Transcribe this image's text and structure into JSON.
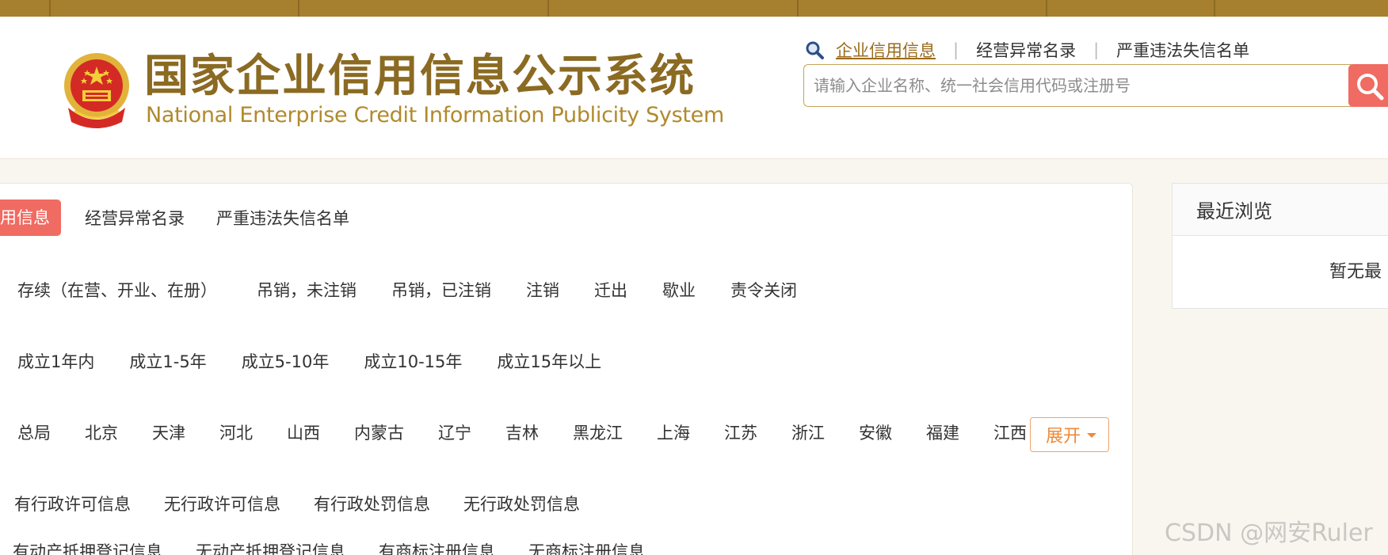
{
  "header": {
    "title_cn": "国家企业信用信息公示系统",
    "title_en": "National Enterprise Credit Information Publicity System",
    "search_tabs": [
      "企业信用信息",
      "经营异常名录",
      "严重违法失信名单"
    ],
    "search_placeholder": "请输入企业名称、统一社会信用代码或注册号"
  },
  "category_tabs": {
    "active": "用信息",
    "items": [
      "经营异常名录",
      "严重违法失信名单"
    ]
  },
  "filters": {
    "status": [
      "存续（在营、开业、在册）",
      "吊销，未注销",
      "吊销，已注销",
      "注销",
      "迁出",
      "歇业",
      "责令关闭"
    ],
    "age": [
      "成立1年内",
      "成立1-5年",
      "成立5-10年",
      "成立10-15年",
      "成立15年以上"
    ],
    "region": [
      "总局",
      "北京",
      "天津",
      "河北",
      "山西",
      "内蒙古",
      "辽宁",
      "吉林",
      "黑龙江",
      "上海",
      "江苏",
      "浙江",
      "安徽",
      "福建",
      "江西"
    ],
    "license": [
      "有行政许可信息",
      "无行政许可信息",
      "有行政处罚信息",
      "无行政处罚信息"
    ],
    "mortgage": [
      "有动产抵押登记信息",
      "无动产抵押登记信息",
      "有商标注册信息",
      "无商标注册信息"
    ],
    "expand_label": "展开"
  },
  "recent": {
    "title": "最近浏览",
    "empty_text": "暂无最"
  },
  "watermark": "CSDN @网安Ruler",
  "colors": {
    "topbar": "#a6802f",
    "brand_text": "#8b6a22",
    "accent_red": "#f06b62",
    "expand_orange": "#ee8a3a"
  },
  "icons": {
    "search_tab": "magnifier-icon",
    "search_button": "search-icon",
    "emblem": "national-emblem-icon",
    "expand": "caret-down-icon"
  }
}
